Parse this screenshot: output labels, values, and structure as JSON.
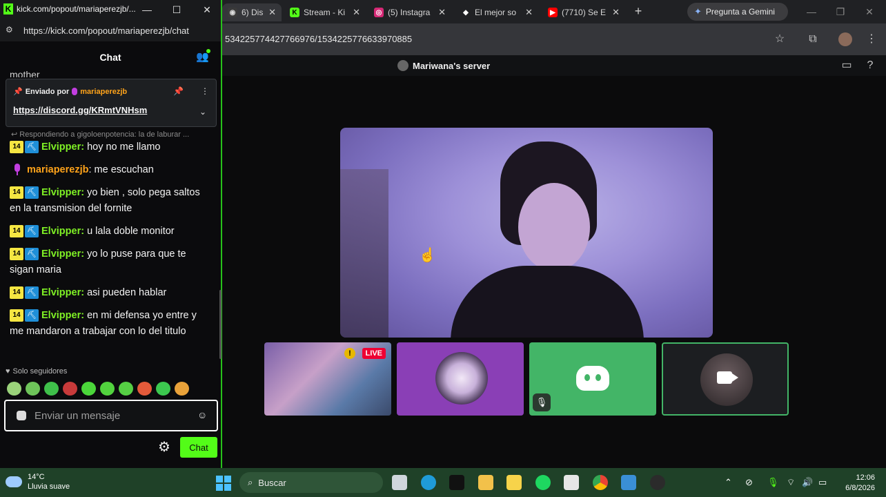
{
  "browser": {
    "tabs": [
      {
        "title": "6) Dis",
        "favicon": "discord-icon",
        "color": "#5865f2"
      },
      {
        "title": "Stream - Ki",
        "favicon": "kick-icon",
        "color": "#53fc18"
      },
      {
        "title": "(5) Instagra",
        "favicon": "instagram-icon",
        "color": "#d62976"
      },
      {
        "title": "El mejor so",
        "favicon": "diamond-icon",
        "color": "#ffffff"
      },
      {
        "title": "(7710) Se E",
        "favicon": "youtube-icon",
        "color": "#ff0000"
      }
    ],
    "gemini_label": "Pregunta a Gemini",
    "url_fragment": "534225774427766976/1534225776633970885",
    "server_name": "Mariwana's server"
  },
  "kick": {
    "window_title": "kick.com/popout/mariaperezjb/...",
    "url": "https://kick.com/popout/mariaperezjb/chat",
    "header_title": "Chat",
    "cut_text": "mother",
    "pinned": {
      "label": "Enviado por",
      "author": "mariaperezjb",
      "link": "https://discord.gg/KRmtVNHsm"
    },
    "reply_text": "Respondiendo a gigoloenpotencia: la de laburar ...",
    "messages": [
      {
        "badge": "14",
        "user": "Elvipper",
        "text": "hoy no me llamo",
        "type": "sub"
      },
      {
        "user": "mariaperezjb",
        "text": "me escuchan",
        "type": "host"
      },
      {
        "badge": "14",
        "user": "Elvipper",
        "text": "yo bien , solo pega saltos en la transmision del fornite",
        "type": "sub"
      },
      {
        "badge": "14",
        "user": "Elvipper",
        "text": "u lala doble monitor",
        "type": "sub"
      },
      {
        "badge": "14",
        "user": "Elvipper",
        "text": "yo lo puse para que te sigan maria",
        "type": "sub"
      },
      {
        "badge": "14",
        "user": "Elvipper",
        "text": "asi pueden hablar",
        "type": "sub"
      },
      {
        "badge": "14",
        "user": "Elvipper",
        "text": "en mi defensa yo entre y me mandaron a trabajar con lo del titulo",
        "type": "sub"
      }
    ],
    "followers_mode": "Solo seguidores",
    "emote_colors": [
      "#9ad27a",
      "#6ec45a",
      "#3fbf4a",
      "#c83a3a",
      "#4bd63a",
      "#52d23e",
      "#56cf44",
      "#e35a3a",
      "#3cc84f",
      "#e9a23a"
    ],
    "input_placeholder": "Enviar un mensaje",
    "send_label": "Chat"
  },
  "live_badge": "LIVE",
  "taskbar": {
    "weather_temp": "14°C",
    "weather_desc": "Lluvia suave",
    "search_label": "Buscar",
    "time": "12:06",
    "date": "6/8/2026"
  }
}
